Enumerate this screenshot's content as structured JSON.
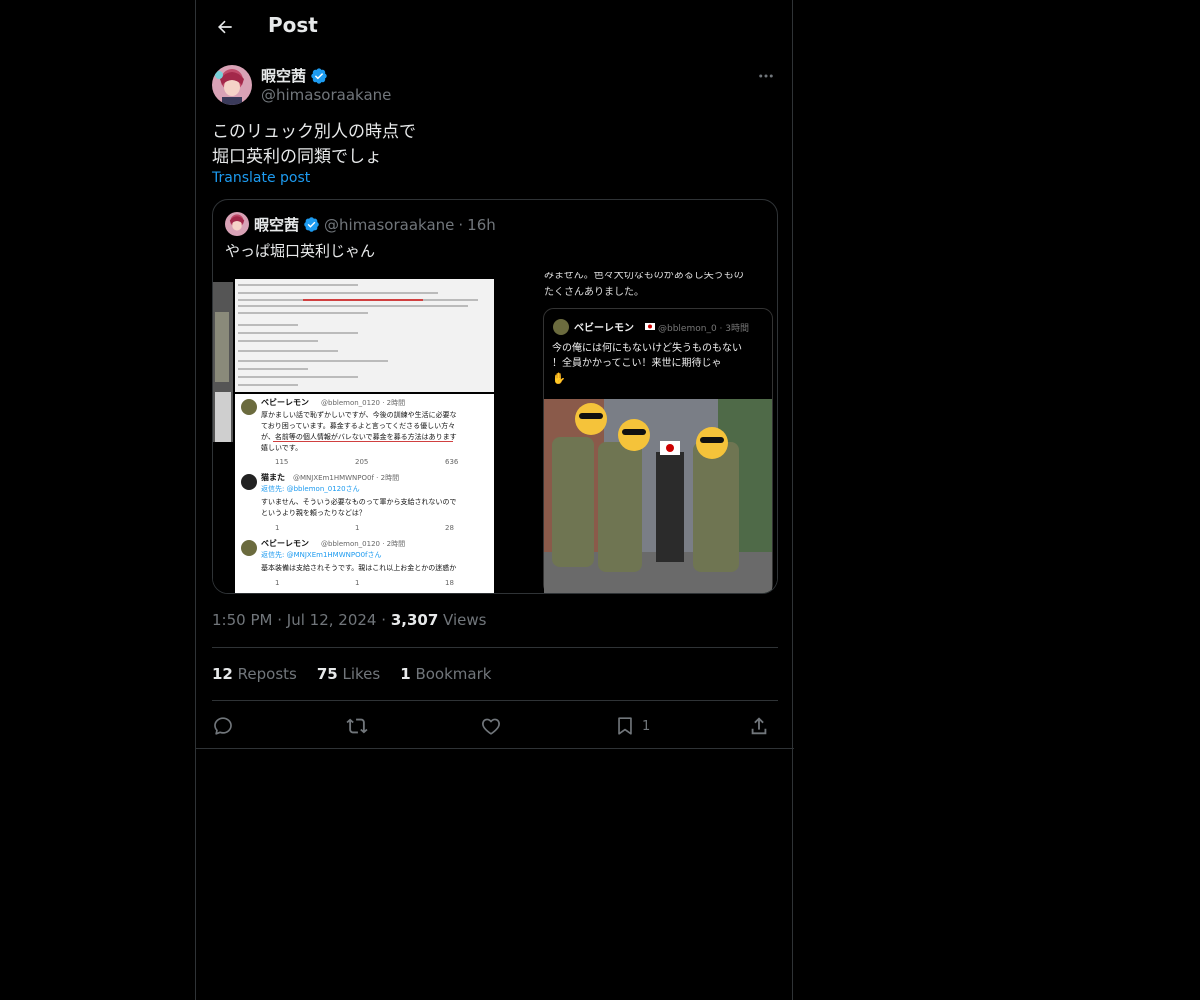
{
  "header": {
    "title": "Post"
  },
  "author": {
    "name": "暇空茜",
    "handle": "@himasoraakane"
  },
  "post": {
    "lines": [
      "このリュック別人の時点で",
      "堀口英利の同類でしょ"
    ],
    "translate_label": "Translate post"
  },
  "quote": {
    "name": "暇空茜",
    "handle": "@himasoraakane",
    "separator": "·",
    "time": "16h",
    "text": "やっぱ堀口英利じゃん",
    "left_image": {
      "tweet1_name": "ベビーレモン",
      "tweet1_handle": "@bblemon_0120 · 2時間",
      "tweet1_body": [
        "厚かましい話で恥ずかしいですが、今後の訓練や生活に必要な",
        "ており困っています。募金するよと言ってくださる優しい方々",
        "が、名前等の個人情報がバレないで募金を募る方法はあります",
        "嬉しいです。"
      ],
      "tweet1_counts": [
        "115",
        "205",
        "636"
      ],
      "tweet2_name": "猫また",
      "tweet2_handle": "@MNJXEm1HMWNPO0f · 2時間",
      "tweet2_reply": "返信先: @bblemon_0120さん",
      "tweet2_body": [
        "すいません、そういう必要なものって軍から支給されないので",
        "というより親を頼ったりなどは？"
      ],
      "tweet2_counts": [
        "1",
        "1",
        "28"
      ],
      "tweet3_name": "ベビーレモン",
      "tweet3_handle": "@bblemon_0120 · 2時間",
      "tweet3_reply": "返信先: @MNJXEm1HMWNPO0fさん",
      "tweet3_body": [
        "基本装備は支給されそうです。親はこれ以上お金とかの迷惑か"
      ],
      "tweet3_counts": [
        "1",
        "1",
        "18"
      ]
    },
    "right_image": {
      "top_text": [
        "みません。色々大切なものがあるし失うもの",
        "たくさんありました。"
      ],
      "inner_name": "ベビーレモン",
      "inner_handle": "@bblemon_0 · 3時間",
      "inner_body": [
        "今の俺には何にもないけど失うものもない",
        "！全員かかってこい！来世に期待じゃ"
      ]
    }
  },
  "meta": {
    "time": "1:50 PM",
    "sep": "·",
    "date": "Jul 12, 2024",
    "views_count": "3,307",
    "views_label": "Views"
  },
  "stats": {
    "reposts_count": "12",
    "reposts_label": "Reposts",
    "likes_count": "75",
    "likes_label": "Likes",
    "bookmarks_count": "1",
    "bookmarks_label": "Bookmark"
  },
  "actions": {
    "bookmark_count": "1"
  },
  "colors": {
    "accent": "#1d9bf0",
    "text": "#e7e9ea",
    "muted": "#71767b",
    "border": "#2f3336"
  },
  "icons": [
    "back-arrow-icon",
    "verified-badge-icon",
    "more-icon",
    "reply-icon",
    "repost-icon",
    "like-icon",
    "bookmark-icon",
    "share-icon"
  ]
}
